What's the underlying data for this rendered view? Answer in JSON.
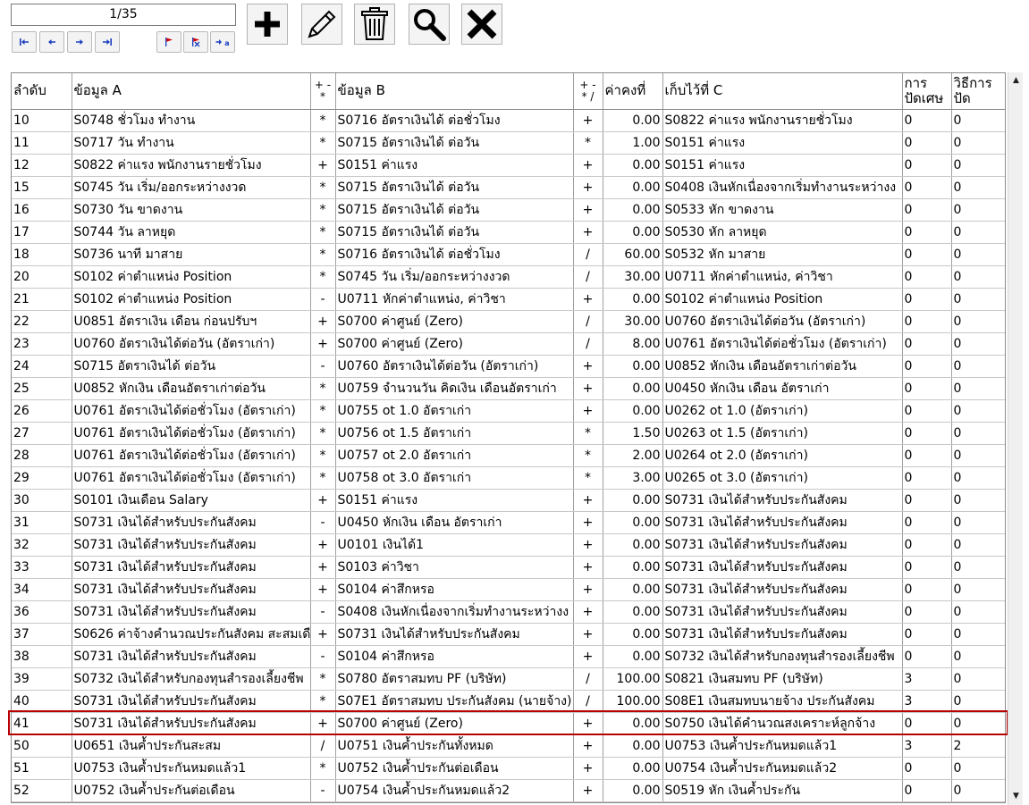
{
  "navigator": {
    "record_counter": "1/35",
    "buttons": [
      "first-record",
      "previous-record",
      "next-record",
      "last-record",
      "set-bookmark",
      "clear-bookmark",
      "goto-bookmark"
    ],
    "bookmark_glyph": "a"
  },
  "toolbar": {
    "buttons": [
      "add-icon",
      "edit-icon",
      "delete-icon",
      "search-icon",
      "close-icon"
    ]
  },
  "grid": {
    "columns": {
      "seq": "ลำดับ",
      "data_a": "ข้อมูล A",
      "op1_line1": "+ -",
      "op1_line2": "*",
      "data_b": "ข้อมูล B",
      "op2_line1": "+ -",
      "op2_line2": "* /",
      "constant": "ค่าคงที่",
      "store_c": "เก็บไว้ที่ C",
      "rounding": "การปัดเศษ",
      "rounding_method": "วิธีการปัด"
    },
    "selected_index": 27,
    "rows": [
      {
        "seq": "10",
        "a": "S0748  ชั่วโมง ทำงาน",
        "op1": "*",
        "b": "S0716  อัตราเงินได้ ต่อชั่วโมง",
        "op2": "+",
        "k": "0.00",
        "c": "S0822  ค่าแรง พนักงานรายชั่วโมง",
        "r": "0",
        "m": "0"
      },
      {
        "seq": "11",
        "a": "S0717  วัน ทำงาน",
        "op1": "*",
        "b": "S0715  อัตราเงินได้ ต่อวัน",
        "op2": "*",
        "k": "1.00",
        "c": "S0151  ค่าแรง",
        "r": "0",
        "m": "0"
      },
      {
        "seq": "12",
        "a": "S0822  ค่าแรง พนักงานรายชั่วโมง",
        "op1": "+",
        "b": "S0151  ค่าแรง",
        "op2": "+",
        "k": "0.00",
        "c": "S0151  ค่าแรง",
        "r": "0",
        "m": "0"
      },
      {
        "seq": "15",
        "a": "S0745  วัน เริ่ม/ออกระหว่างงวด",
        "op1": "*",
        "b": "S0715  อัตราเงินได้ ต่อวัน",
        "op2": "+",
        "k": "0.00",
        "c": "S0408  เงินหักเนื่องจากเริ่มทำงานระหว่างง",
        "r": "0",
        "m": "0"
      },
      {
        "seq": "16",
        "a": "S0730  วัน ขาดงาน",
        "op1": "*",
        "b": "S0715  อัตราเงินได้ ต่อวัน",
        "op2": "+",
        "k": "0.00",
        "c": "S0533  หัก ขาดงาน",
        "r": "0",
        "m": "0"
      },
      {
        "seq": "17",
        "a": "S0744  วัน ลาหยุด",
        "op1": "*",
        "b": "S0715  อัตราเงินได้ ต่อวัน",
        "op2": "+",
        "k": "0.00",
        "c": "S0530  หัก ลาหยุด",
        "r": "0",
        "m": "0"
      },
      {
        "seq": "18",
        "a": "S0736  นาที มาสาย",
        "op1": "*",
        "b": "S0716  อัตราเงินได้ ต่อชั่วโมง",
        "op2": "/",
        "k": "60.00",
        "c": "S0532  หัก มาสาย",
        "r": "0",
        "m": "0"
      },
      {
        "seq": "20",
        "a": "S0102  ค่าตำแหน่ง Position",
        "op1": "*",
        "b": "S0745  วัน เริ่ม/ออกระหว่างงวด",
        "op2": "/",
        "k": "30.00",
        "c": "U0711  หักค่าตำแหน่ง, ค่าวิชา",
        "r": "0",
        "m": "0"
      },
      {
        "seq": "21",
        "a": "S0102  ค่าตำแหน่ง Position",
        "op1": "-",
        "b": "U0711  หักค่าตำแหน่ง, ค่าวิชา",
        "op2": "+",
        "k": "0.00",
        "c": "S0102  ค่าตำแหน่ง Position",
        "r": "0",
        "m": "0"
      },
      {
        "seq": "22",
        "a": "U0851  อัตราเงิน เดือน ก่อนปรับฯ",
        "op1": "+",
        "b": "S0700  ค่าศูนย์ (Zero)",
        "op2": "/",
        "k": "30.00",
        "c": "U0760  อัตราเงินได้ต่อวัน (อัตราเก่า)",
        "r": "0",
        "m": "0"
      },
      {
        "seq": "23",
        "a": "U0760  อัตราเงินได้ต่อวัน (อัตราเก่า)",
        "op1": "+",
        "b": "S0700  ค่าศูนย์ (Zero)",
        "op2": "/",
        "k": "8.00",
        "c": "U0761  อัตราเงินได้ต่อชั่วโมง (อัตราเก่า)",
        "r": "0",
        "m": "0"
      },
      {
        "seq": "24",
        "a": "S0715  อัตราเงินได้ ต่อวัน",
        "op1": "-",
        "b": "U0760  อัตราเงินได้ต่อวัน (อัตราเก่า)",
        "op2": "+",
        "k": "0.00",
        "c": "U0852  หักเงิน เดือนอัตราเก่าต่อวัน",
        "r": "0",
        "m": "0"
      },
      {
        "seq": "25",
        "a": "U0852  หักเงิน เดือนอัตราเก่าต่อวัน",
        "op1": "*",
        "b": "U0759  จำนวนวัน คิดเงิน เดือนอัตราเก่า",
        "op2": "+",
        "k": "0.00",
        "c": "U0450  หักเงิน เดือน อัตราเก่า",
        "r": "0",
        "m": "0"
      },
      {
        "seq": "26",
        "a": "U0761  อัตราเงินได้ต่อชั่วโมง (อัตราเก่า)",
        "op1": "*",
        "b": "U0755  ot 1.0 อัตราเก่า",
        "op2": "+",
        "k": "0.00",
        "c": "U0262  ot 1.0 (อัตราเก่า)",
        "r": "0",
        "m": "0"
      },
      {
        "seq": "27",
        "a": "U0761  อัตราเงินได้ต่อชั่วโมง (อัตราเก่า)",
        "op1": "*",
        "b": "U0756  ot 1.5 อัตราเก่า",
        "op2": "*",
        "k": "1.50",
        "c": "U0263  ot 1.5 (อัตราเก่า)",
        "r": "0",
        "m": "0"
      },
      {
        "seq": "28",
        "a": "U0761  อัตราเงินได้ต่อชั่วโมง (อัตราเก่า)",
        "op1": "*",
        "b": "U0757  ot 2.0 อัตราเก่า",
        "op2": "*",
        "k": "2.00",
        "c": "U0264  ot 2.0 (อัตราเก่า)",
        "r": "0",
        "m": "0"
      },
      {
        "seq": "29",
        "a": "U0761  อัตราเงินได้ต่อชั่วโมง (อัตราเก่า)",
        "op1": "*",
        "b": "U0758  ot 3.0 อัตราเก่า",
        "op2": "*",
        "k": "3.00",
        "c": "U0265  ot 3.0 (อัตราเก่า)",
        "r": "0",
        "m": "0"
      },
      {
        "seq": "30",
        "a": "S0101  เงินเดือน Salary",
        "op1": "+",
        "b": "S0151  ค่าแรง",
        "op2": "+",
        "k": "0.00",
        "c": "S0731  เงินได้สำหรับประกันสังคม",
        "r": "0",
        "m": "0"
      },
      {
        "seq": "31",
        "a": "S0731  เงินได้สำหรับประกันสังคม",
        "op1": "-",
        "b": "U0450  หักเงิน เดือน อัตราเก่า",
        "op2": "+",
        "k": "0.00",
        "c": "S0731  เงินได้สำหรับประกันสังคม",
        "r": "0",
        "m": "0"
      },
      {
        "seq": "32",
        "a": "S0731  เงินได้สำหรับประกันสังคม",
        "op1": "+",
        "b": "U0101  เงินได้1",
        "op2": "+",
        "k": "0.00",
        "c": "S0731  เงินได้สำหรับประกันสังคม",
        "r": "0",
        "m": "0"
      },
      {
        "seq": "33",
        "a": "S0731  เงินได้สำหรับประกันสังคม",
        "op1": "+",
        "b": "S0103  ค่าวิชา",
        "op2": "+",
        "k": "0.00",
        "c": "S0731  เงินได้สำหรับประกันสังคม",
        "r": "0",
        "m": "0"
      },
      {
        "seq": "34",
        "a": "S0731  เงินได้สำหรับประกันสังคม",
        "op1": "+",
        "b": "S0104  ค่าสึกหรอ",
        "op2": "+",
        "k": "0.00",
        "c": "S0731  เงินได้สำหรับประกันสังคม",
        "r": "0",
        "m": "0"
      },
      {
        "seq": "36",
        "a": "S0731  เงินได้สำหรับประกันสังคม",
        "op1": "-",
        "b": "S0408  เงินหักเนื่องจากเริ่มทำงานระหว่างง",
        "op2": "+",
        "k": "0.00",
        "c": "S0731  เงินได้สำหรับประกันสังคม",
        "r": "0",
        "m": "0"
      },
      {
        "seq": "37",
        "a": "S0626  ค่าจ้างคำนวณประกันสังคม สะสมเดื",
        "op1": "+",
        "b": "S0731  เงินได้สำหรับประกันสังคม",
        "op2": "+",
        "k": "0.00",
        "c": "S0731  เงินได้สำหรับประกันสังคม",
        "r": "0",
        "m": "0"
      },
      {
        "seq": "38",
        "a": "S0731  เงินได้สำหรับประกันสังคม",
        "op1": "-",
        "b": "S0104  ค่าสึกหรอ",
        "op2": "+",
        "k": "0.00",
        "c": "S0732  เงินได้สำหรับกองทุนสำรองเลี้ยงชีพ",
        "r": "0",
        "m": "0"
      },
      {
        "seq": "39",
        "a": "S0732  เงินได้สำหรับกองทุนสำรองเลี้ยงชีพ",
        "op1": "*",
        "b": "S0780  อัตราสมทบ PF (บริษัท)",
        "op2": "/",
        "k": "100.00",
        "c": "S0821  เงินสมทบ PF (บริษัท)",
        "r": "3",
        "m": "0"
      },
      {
        "seq": "40",
        "a": "S0731  เงินได้สำหรับประกันสังคม",
        "op1": "*",
        "b": "S07E1  อัตราสมทบ ประกันสังคม (นายจ้าง)",
        "op2": "/",
        "k": "100.00",
        "c": "S08E1  เงินสมทบนายจ้าง ประกันสังคม",
        "r": "3",
        "m": "0"
      },
      {
        "seq": "41",
        "a": "S0731  เงินได้สำหรับประกันสังคม",
        "op1": "+",
        "b": "S0700  ค่าศูนย์ (Zero)",
        "op2": "+",
        "k": "0.00",
        "c": "S0750  เงินได้คำนวณสงเคราะห์ลูกจ้าง",
        "r": "0",
        "m": "0"
      },
      {
        "seq": "50",
        "a": "U0651  เงินค้ำประกันสะสม",
        "op1": "/",
        "b": "U0751  เงินค้ำประกันทั้งหมด",
        "op2": "+",
        "k": "0.00",
        "c": "U0753  เงินค้ำประกันหมดแล้ว1",
        "r": "3",
        "m": "2"
      },
      {
        "seq": "51",
        "a": "U0753  เงินค้ำประกันหมดแล้ว1",
        "op1": "*",
        "b": "U0752  เงินค้ำประกันต่อเดือน",
        "op2": "+",
        "k": "0.00",
        "c": "U0754  เงินค้ำประกันหมดแล้ว2",
        "r": "0",
        "m": "0"
      },
      {
        "seq": "52",
        "a": "U0752  เงินค้ำประกันต่อเดือน",
        "op1": "-",
        "b": "U0754  เงินค้ำประกันหมดแล้ว2",
        "op2": "+",
        "k": "0.00",
        "c": "S0519  หัก เงินค้ำประกัน",
        "r": "0",
        "m": "0"
      }
    ]
  }
}
